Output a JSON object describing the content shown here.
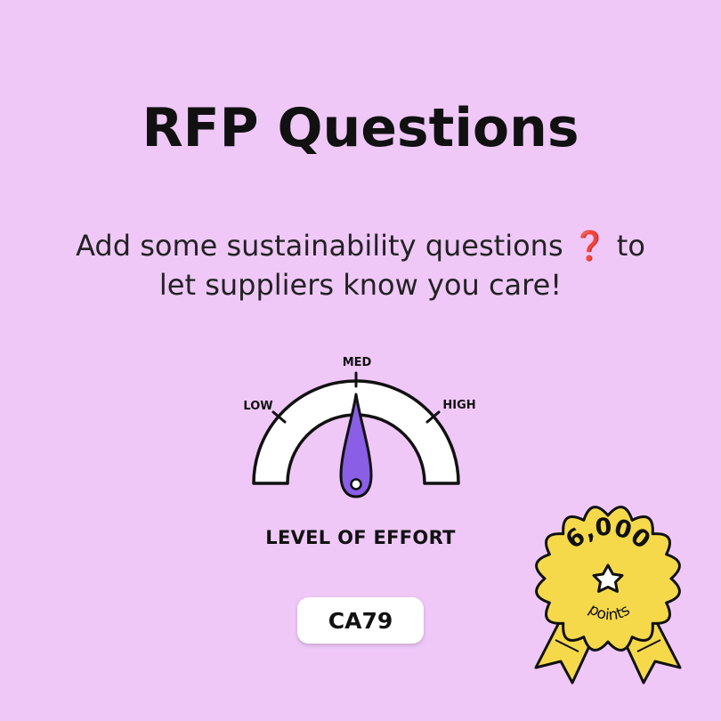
{
  "title": "RFP Questions",
  "subtitle": {
    "before": "Add some sustainability questions",
    "icon_glyph": "❓",
    "after": "to let suppliers know you care!"
  },
  "gauge": {
    "label_low": "LOW",
    "label_med": "MED",
    "label_high": "HIGH",
    "level": "MED",
    "caption": "LEVEL OF EFFORT",
    "needle_color": "#8b5ee6"
  },
  "code": "CA79",
  "badge": {
    "points_value": "6,000",
    "points_label": "points",
    "color": "#f6d94a"
  },
  "colors": {
    "background": "#efc8f8",
    "question_mark": "#d62b2b"
  }
}
